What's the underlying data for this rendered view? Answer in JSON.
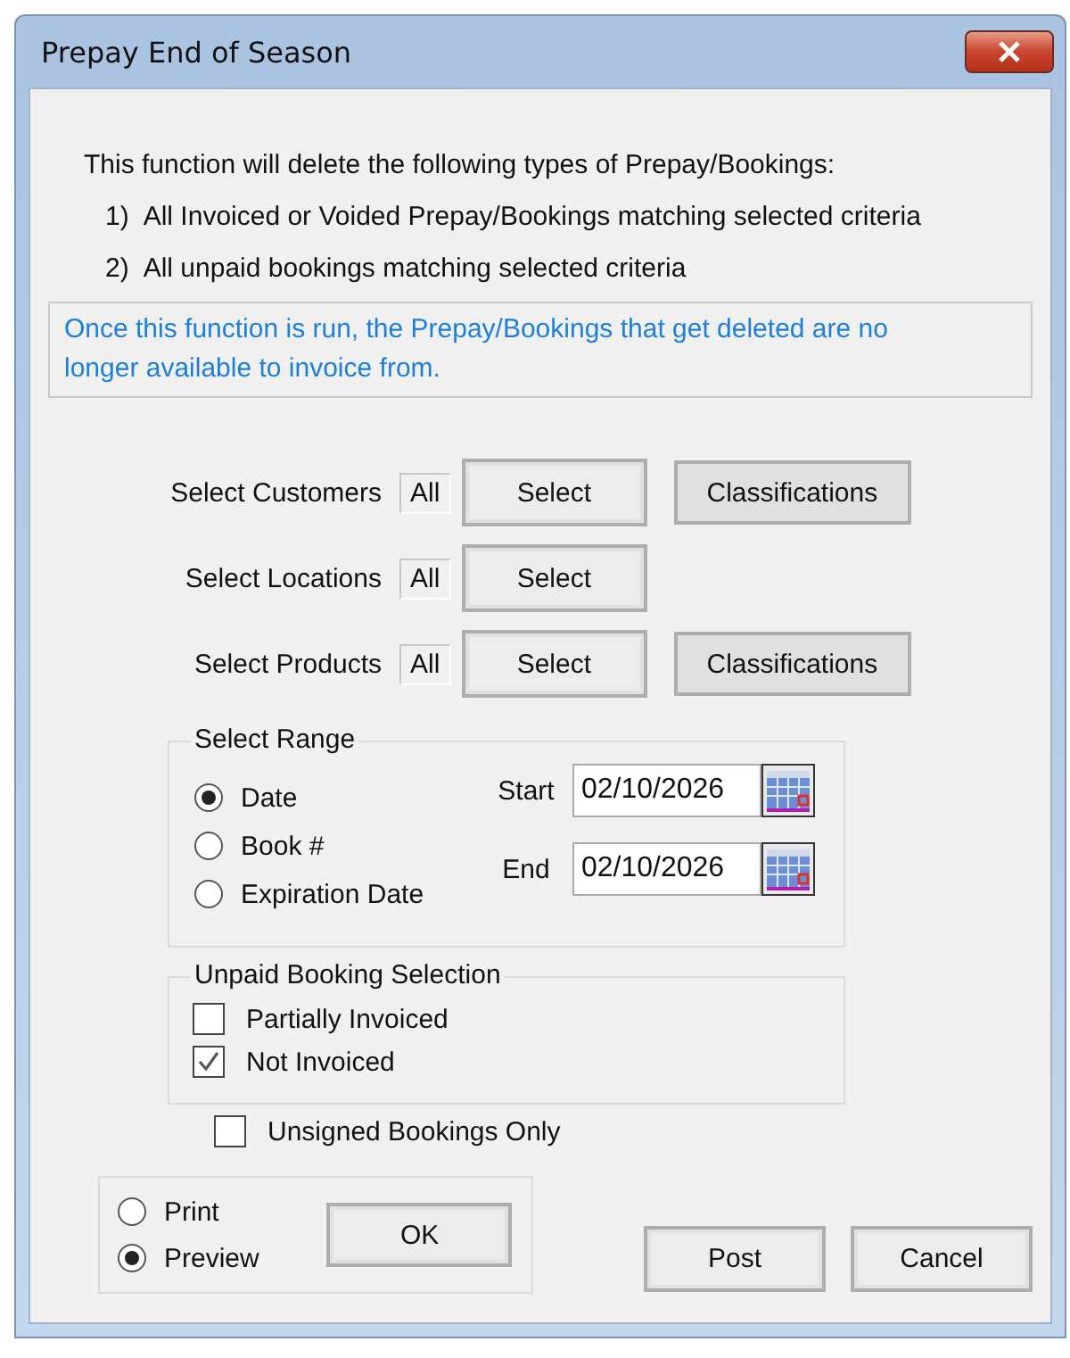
{
  "window": {
    "title": "Prepay End of Season"
  },
  "intro": "This function will delete the following types of Prepay/Bookings:",
  "criteria": [
    {
      "number": "1)",
      "text": "All Invoiced or Voided Prepay/Bookings matching selected criteria"
    },
    {
      "number": "2)",
      "text": "All unpaid bookings matching selected criteria"
    }
  ],
  "notice": "Once this function is run, the Prepay/Bookings that get deleted are no longer available to invoice from.",
  "selectors": [
    {
      "label": "Select Customers",
      "value": "All",
      "buttons": [
        "Select",
        "Classifications"
      ]
    },
    {
      "label": "Select Locations",
      "value": "All",
      "buttons": [
        "Select"
      ]
    },
    {
      "label": "Select Products",
      "value": "All",
      "buttons": [
        "Select",
        "Classifications"
      ]
    }
  ],
  "range": {
    "title": "Select Range",
    "options": [
      {
        "label": "Date",
        "selected": true
      },
      {
        "label": "Book #",
        "selected": false
      },
      {
        "label": "Expiration Date",
        "selected": false
      }
    ],
    "dates": [
      {
        "label": "Start",
        "value": "02/10/2026"
      },
      {
        "label": "End",
        "value": "02/10/2026"
      }
    ]
  },
  "unpaid": {
    "title": "Unpaid Booking Selection",
    "options": [
      {
        "label": "Partially Invoiced",
        "checked": false
      },
      {
        "label": "Not Invoiced",
        "checked": true
      }
    ]
  },
  "unsigned": {
    "label": "Unsigned Bookings Only",
    "checked": false
  },
  "output": {
    "options": [
      {
        "label": "Print",
        "selected": false
      },
      {
        "label": "Preview",
        "selected": true
      }
    ],
    "button": "OK"
  },
  "buttons": [
    "Post",
    "Cancel"
  ]
}
